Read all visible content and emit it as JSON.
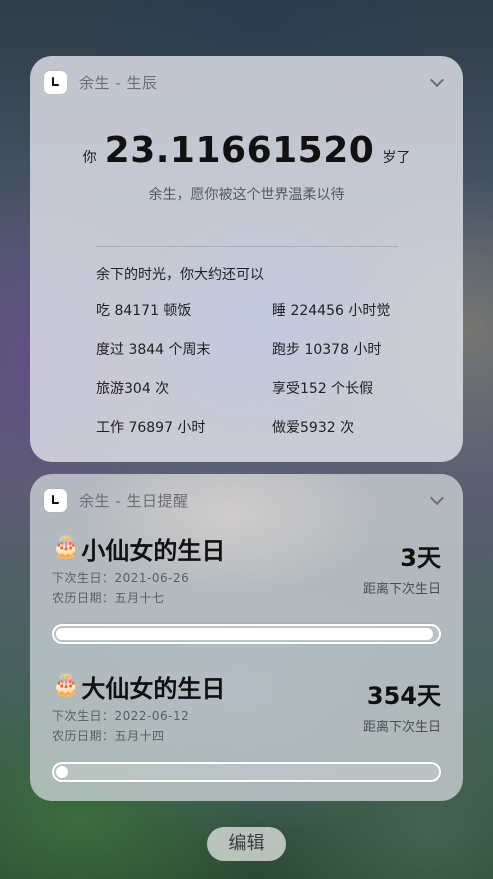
{
  "widgets": {
    "age": {
      "title": "余生 - 生辰",
      "prefix": "你",
      "age": "23.11661520",
      "suffix": "岁了",
      "motto": "余生，愿你被这个世界温柔以待",
      "remaining_title": "余下的时光，你大约还可以",
      "stats": [
        "吃 84171 顿饭",
        "睡 224456 小时觉",
        "度过 3844 个周末",
        "跑步 10378 小时",
        "旅游304 次",
        "享受152 个长假",
        "工作 76897 小时",
        "做爱5932 次"
      ]
    },
    "birthday": {
      "title": "余生 - 生日提醒",
      "items": [
        {
          "icon": "🎂",
          "name": "小仙女的生日",
          "next": "下次生日：2021-06-26",
          "lunar": "农历日期：五月十七",
          "days": "3天",
          "days_label": "距离下次生日",
          "progress": 0.99
        },
        {
          "icon": "🎂",
          "name": "大仙女的生日",
          "next": "下次生日：2022-06-12",
          "lunar": "农历日期：五月十四",
          "days": "354天",
          "days_label": "距离下次生日",
          "progress": 0.03
        }
      ]
    }
  },
  "edit_button": "编辑"
}
